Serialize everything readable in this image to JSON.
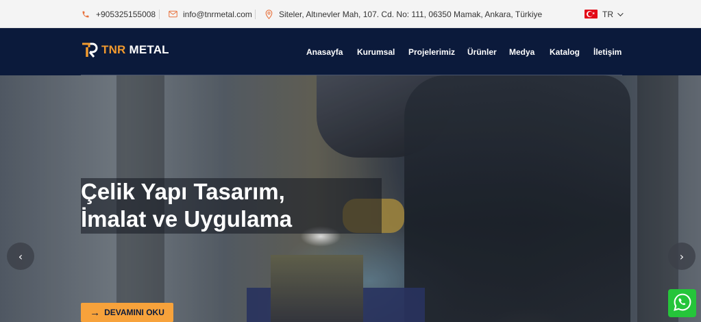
{
  "topbar": {
    "phone": "+905325155008",
    "email": "info@tnrmetal.com",
    "address": "Siteler, Altınevler Mah, 107. Cd. No: 111, 06350 Mamak, Ankara, Türkiye",
    "language": "TR"
  },
  "logo": {
    "tnr": "TNR",
    "metal": "METAL",
    "colors": {
      "orange": "#f29a2e",
      "white": "#ffffff"
    }
  },
  "nav": {
    "items": [
      {
        "label": "Anasayfa"
      },
      {
        "label": "Kurumsal"
      },
      {
        "label": "Projelerimiz"
      },
      {
        "label": "Ürünler"
      },
      {
        "label": "Medya"
      },
      {
        "label": "Katalog"
      },
      {
        "label": "İletişim"
      }
    ]
  },
  "hero": {
    "headline_line1": "Çelik Yapı Tasarım,",
    "headline_line2": "İmalat ve Uygulama",
    "cta_label": "DEVAMINI OKU",
    "prev_icon": "chevron-left-icon",
    "next_icon": "chevron-right-icon"
  },
  "colors": {
    "accent": "#f7a23b",
    "navy": "#0b1a3b",
    "whatsapp": "#25c53a"
  }
}
